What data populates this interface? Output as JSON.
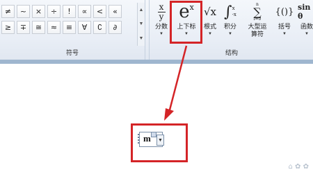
{
  "ribbon": {
    "symbols_group": {
      "label": "符号",
      "rows": [
        [
          "≠",
          "~",
          "×",
          "÷",
          "!",
          "∝",
          "<",
          "«"
        ],
        [
          "≥",
          "∓",
          "≅",
          "≈",
          "≡",
          "∀",
          "∁",
          "∂"
        ]
      ]
    },
    "structures_group": {
      "label": "结构",
      "buttons": {
        "fraction": {
          "label": "分数",
          "num": "x",
          "den": "y"
        },
        "script": {
          "label": "上下标",
          "base": "e",
          "sup": "x"
        },
        "radical": {
          "label": "根式",
          "text": "√x"
        },
        "integral": {
          "label": "积分",
          "text": "∫",
          "sup": "x",
          "sub": "-x"
        },
        "large_operator": {
          "label": "大型运算符",
          "text": "∑",
          "sup": "n",
          "sub": "i=0"
        },
        "bracket": {
          "label": "括号",
          "text": "{()}"
        },
        "function": {
          "label": "函数",
          "text": "sin θ"
        }
      }
    }
  },
  "equation": {
    "base": "m"
  },
  "colors": {
    "highlight": "#d42427"
  }
}
